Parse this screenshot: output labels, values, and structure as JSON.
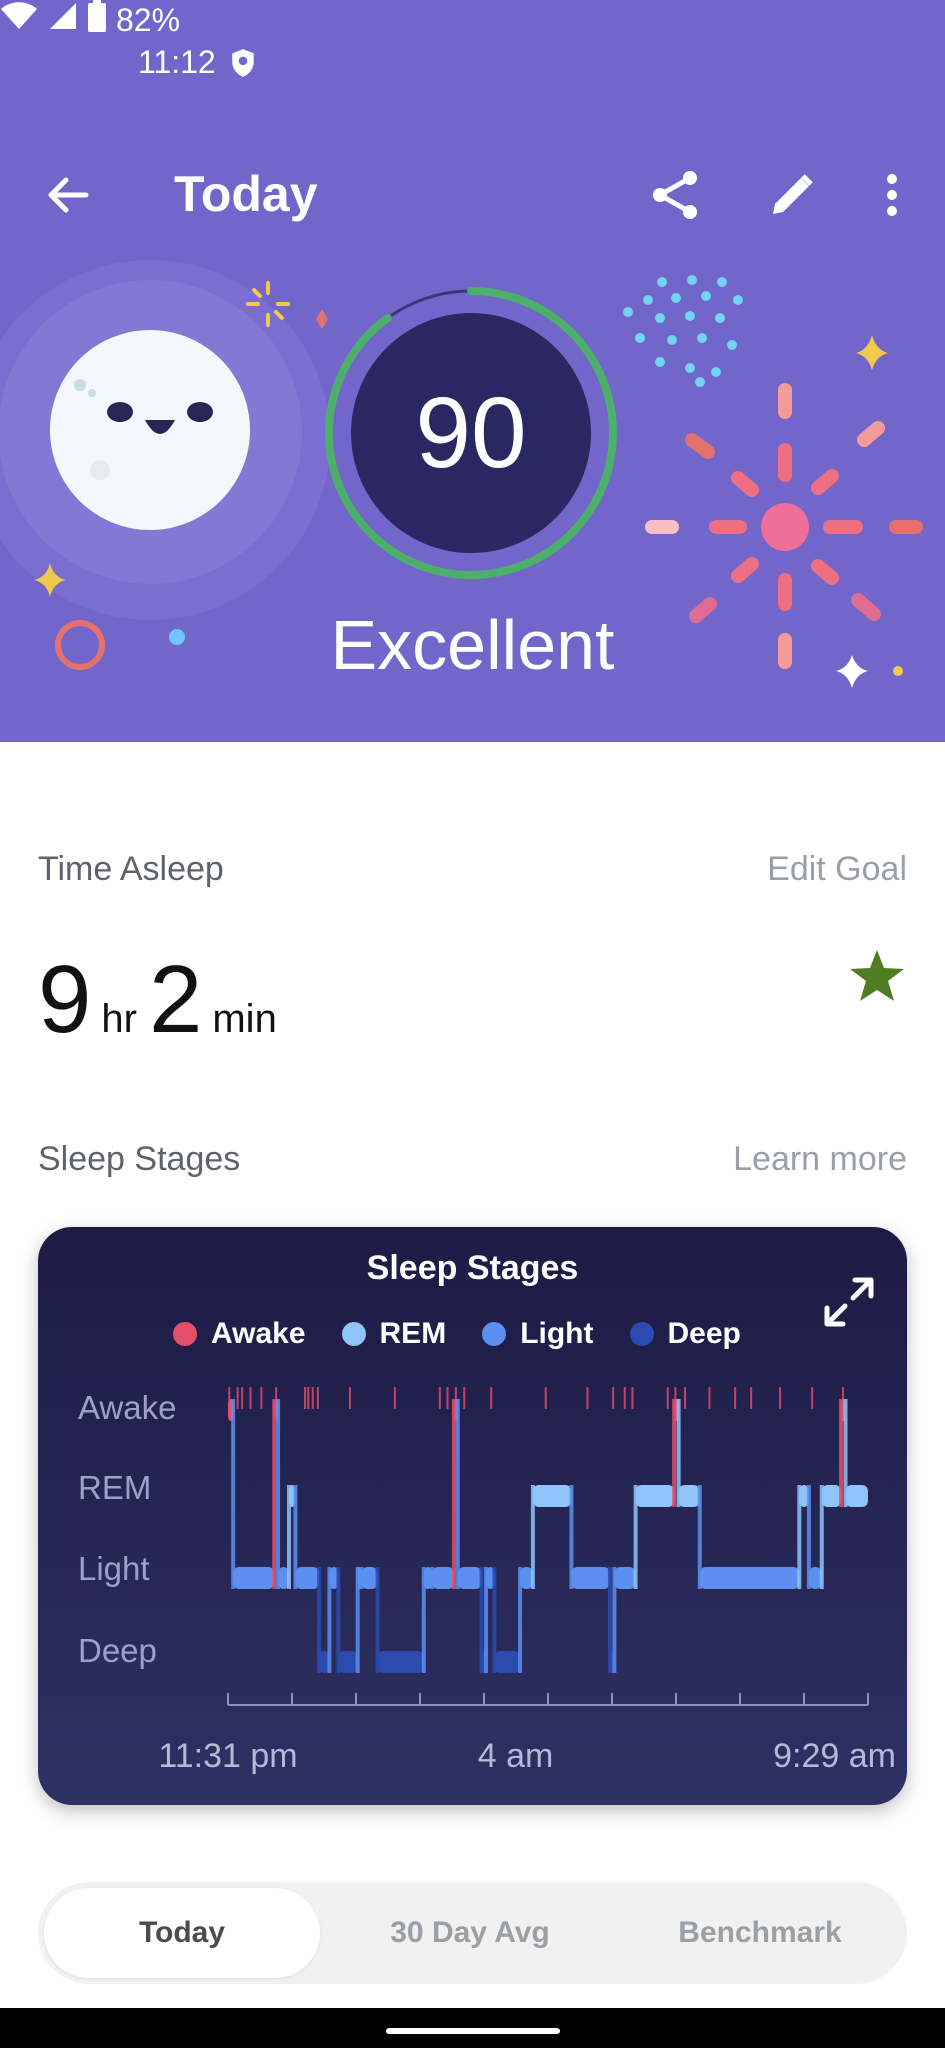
{
  "status_bar": {
    "time": "11:12",
    "battery": "82%"
  },
  "app_bar": {
    "title": "Today",
    "icons": [
      "back-arrow-icon",
      "share-icon",
      "edit-icon",
      "more-icon"
    ]
  },
  "score": {
    "value": "90",
    "label": "Excellent",
    "progress": 0.9
  },
  "time_asleep": {
    "label": "Time Asleep",
    "edit_goal": "Edit Goal",
    "hours": "9",
    "hours_unit": "hr",
    "minutes": "2",
    "minutes_unit": "min",
    "goal_met_icon": "star-icon"
  },
  "sleep_stages": {
    "label": "Sleep Stages",
    "learn_more": "Learn more"
  },
  "chart_data": {
    "type": "line",
    "title": "Sleep Stages",
    "series": [
      {
        "name": "Awake",
        "color": "#e64f6b"
      },
      {
        "name": "REM",
        "color": "#8fc4f8"
      },
      {
        "name": "Light",
        "color": "#5c8ff0"
      },
      {
        "name": "Deep",
        "color": "#2b4bb0"
      }
    ],
    "y_categories": [
      "Awake",
      "REM",
      "Light",
      "Deep"
    ],
    "x_tick_labels": [
      "11:31 pm",
      "4 am",
      "9:29 am"
    ],
    "x_range_hours": [
      0,
      9.97
    ],
    "segments": [
      {
        "stage": "Awake",
        "start": 0.0,
        "end": 0.08
      },
      {
        "stage": "Light",
        "start": 0.08,
        "end": 0.72
      },
      {
        "stage": "Awake",
        "start": 0.72,
        "end": 0.78
      },
      {
        "stage": "Light",
        "start": 0.78,
        "end": 0.95
      },
      {
        "stage": "REM",
        "start": 0.95,
        "end": 1.05
      },
      {
        "stage": "Light",
        "start": 1.05,
        "end": 1.42
      },
      {
        "stage": "Deep",
        "start": 1.42,
        "end": 1.58
      },
      {
        "stage": "Light",
        "start": 1.58,
        "end": 1.72
      },
      {
        "stage": "Deep",
        "start": 1.72,
        "end": 2.02
      },
      {
        "stage": "Light",
        "start": 2.02,
        "end": 2.08
      },
      {
        "stage": "Light",
        "start": 2.08,
        "end": 2.33
      },
      {
        "stage": "Deep",
        "start": 2.33,
        "end": 3.05
      },
      {
        "stage": "Light",
        "start": 3.05,
        "end": 3.18
      },
      {
        "stage": "Light",
        "start": 3.18,
        "end": 3.52
      },
      {
        "stage": "Awake",
        "start": 3.52,
        "end": 3.58
      },
      {
        "stage": "Light",
        "start": 3.58,
        "end": 3.95
      },
      {
        "stage": "Deep",
        "start": 3.95,
        "end": 4.02
      },
      {
        "stage": "Light",
        "start": 4.02,
        "end": 4.15
      },
      {
        "stage": "Deep",
        "start": 4.15,
        "end": 4.55
      },
      {
        "stage": "Light",
        "start": 4.55,
        "end": 4.75
      },
      {
        "stage": "REM",
        "start": 4.75,
        "end": 5.35
      },
      {
        "stage": "Light",
        "start": 5.35,
        "end": 5.95
      },
      {
        "stage": "Deep",
        "start": 5.95,
        "end": 6.02
      },
      {
        "stage": "Light",
        "start": 6.02,
        "end": 6.35
      },
      {
        "stage": "REM",
        "start": 6.35,
        "end": 6.95
      },
      {
        "stage": "Awake",
        "start": 6.95,
        "end": 7.02
      },
      {
        "stage": "REM",
        "start": 7.02,
        "end": 7.35
      },
      {
        "stage": "Light",
        "start": 7.35,
        "end": 8.9
      },
      {
        "stage": "REM",
        "start": 8.9,
        "end": 9.05
      },
      {
        "stage": "Light",
        "start": 9.05,
        "end": 9.25
      },
      {
        "stage": "REM",
        "start": 9.25,
        "end": 9.55
      },
      {
        "stage": "Awake",
        "start": 9.55,
        "end": 9.62
      },
      {
        "stage": "REM",
        "start": 9.62,
        "end": 9.97
      }
    ],
    "awake_marks": [
      0.02,
      0.15,
      0.22,
      0.35,
      0.52,
      0.75,
      1.2,
      1.25,
      1.32,
      1.4,
      1.9,
      2.6,
      3.3,
      3.42,
      3.55,
      3.68,
      4.1,
      4.95,
      5.6,
      6.0,
      6.18,
      6.3,
      6.85,
      6.97,
      7.12,
      7.5,
      7.9,
      8.15,
      8.6,
      9.1,
      9.58
    ]
  },
  "segmented_control": {
    "options": [
      "Today",
      "30 Day Avg",
      "Benchmark"
    ],
    "selected": "Today"
  },
  "colors": {
    "hero_background": "#7266cb",
    "score_ring": "#4caf6a",
    "star": "#4e7d22"
  }
}
